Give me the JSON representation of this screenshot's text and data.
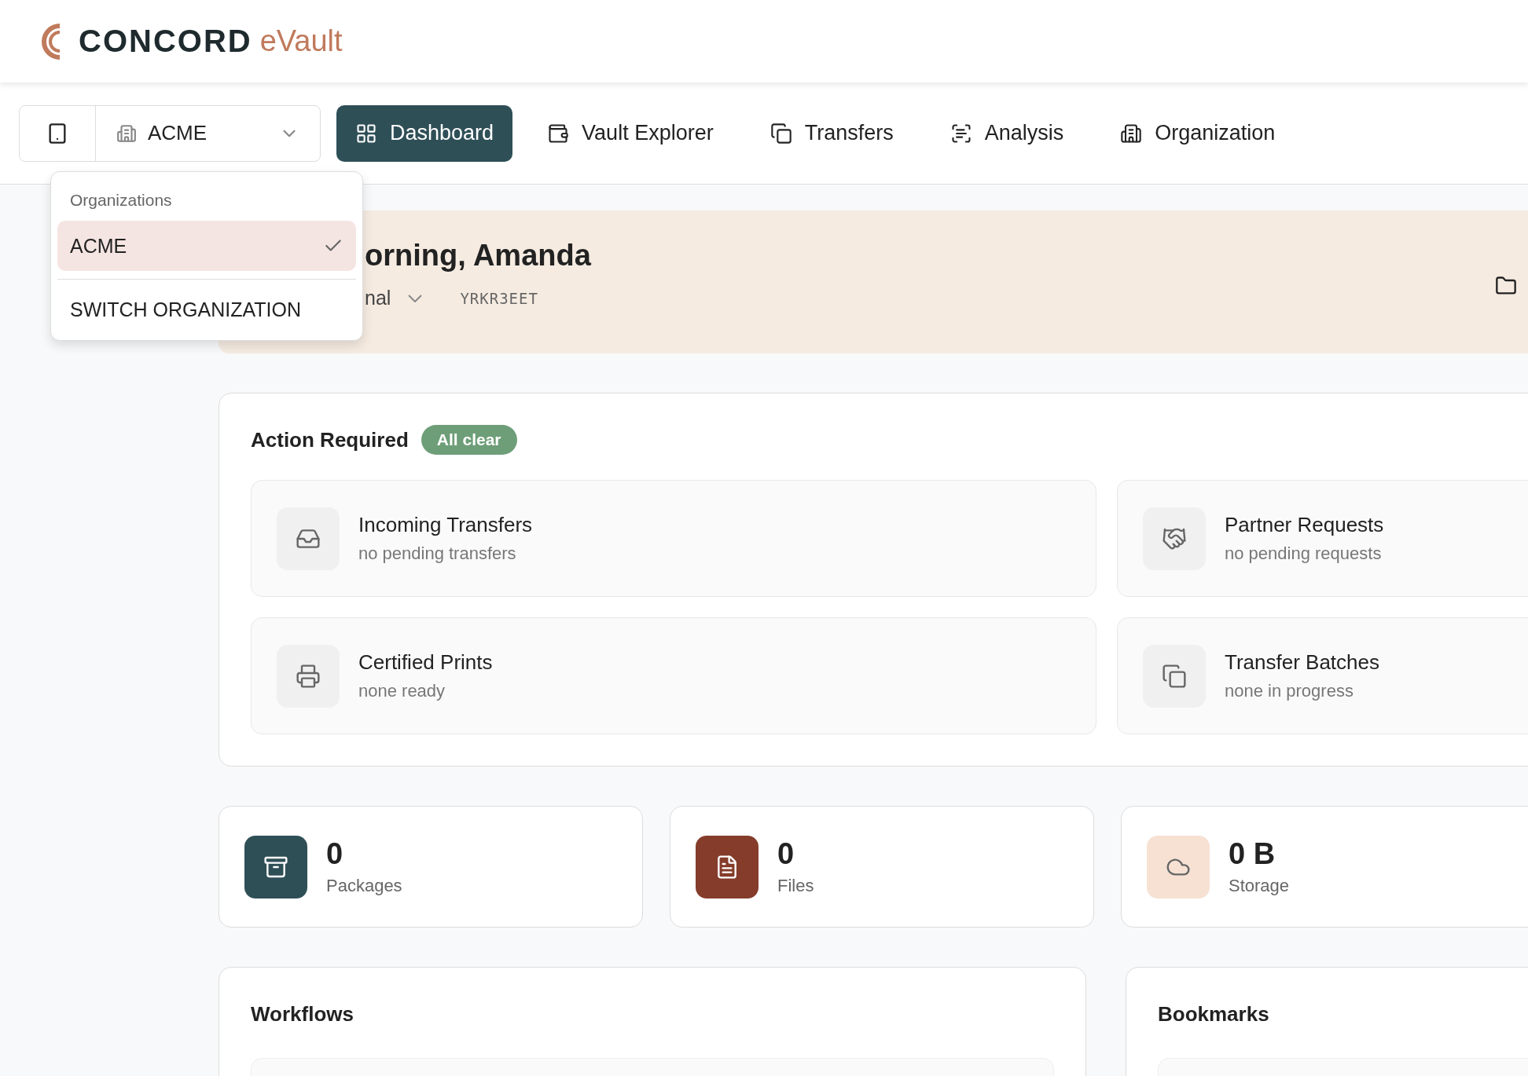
{
  "brand": {
    "name": "CONCORD",
    "product": "eVault"
  },
  "org_selector": {
    "value": "ACME"
  },
  "nav": [
    {
      "label": "Dashboard",
      "selected": true
    },
    {
      "label": "Vault Explorer",
      "selected": false
    },
    {
      "label": "Transfers",
      "selected": false
    },
    {
      "label": "Analysis",
      "selected": false
    },
    {
      "label": "Organization",
      "selected": false
    }
  ],
  "org_menu": {
    "heading": "Organizations",
    "items": [
      {
        "label": "ACME",
        "selected": true
      }
    ],
    "action": "SWITCH ORGANIZATION"
  },
  "banner": {
    "greeting": "orning, Amanda",
    "scope": "nal",
    "code": "YRKR3EET"
  },
  "action_required": {
    "title": "Action Required",
    "badge": "All clear",
    "items": [
      {
        "title": "Incoming Transfers",
        "subtitle": "no pending transfers"
      },
      {
        "title": "Partner Requests",
        "subtitle": "no pending requests"
      },
      {
        "title": "Certified Prints",
        "subtitle": "none ready"
      },
      {
        "title": "Transfer Batches",
        "subtitle": "none in progress"
      }
    ]
  },
  "stats": [
    {
      "value": "0",
      "label": "Packages",
      "color": "#2f4f57"
    },
    {
      "value": "0",
      "label": "Files",
      "color": "#853c2b"
    },
    {
      "value": "0 B",
      "label": "Storage",
      "color": "#f6e1d3"
    }
  ],
  "panels": [
    {
      "title": "Workflows"
    },
    {
      "title": "Bookmarks"
    }
  ]
}
